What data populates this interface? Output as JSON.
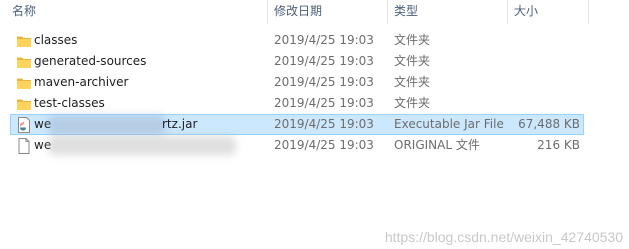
{
  "columns": {
    "name": "名称",
    "date": "修改日期",
    "type": "类型",
    "size": "大小"
  },
  "rows": [
    {
      "name": "classes",
      "date": "2019/4/25 19:03",
      "type": "文件夹",
      "size": "",
      "icon": "folder-icon"
    },
    {
      "name": "generated-sources",
      "date": "2019/4/25 19:03",
      "type": "文件夹",
      "size": "",
      "icon": "folder-icon"
    },
    {
      "name": "maven-archiver",
      "date": "2019/4/25 19:03",
      "type": "文件夹",
      "size": "",
      "icon": "folder-icon"
    },
    {
      "name": "test-classes",
      "date": "2019/4/25 19:03",
      "type": "文件夹",
      "size": "",
      "icon": "folder-icon"
    },
    {
      "name_prefix": "we",
      "name_suffix": "rtz.jar",
      "date": "2019/4/25 19:03",
      "type": "Executable Jar File",
      "size": "67,488 KB",
      "icon": "java-jar-icon",
      "selected": true
    },
    {
      "name_prefix": "we",
      "date": "2019/4/25 19:03",
      "type": "ORIGINAL 文件",
      "size": "216 KB",
      "icon": "file-icon"
    }
  ],
  "watermark": "https://blog.csdn.net/weixin_42740530",
  "colors": {
    "selection": "#cce8ff",
    "selection_border": "#99d1ff",
    "folder": "#ffd35c",
    "header_text": "#4c607a"
  }
}
